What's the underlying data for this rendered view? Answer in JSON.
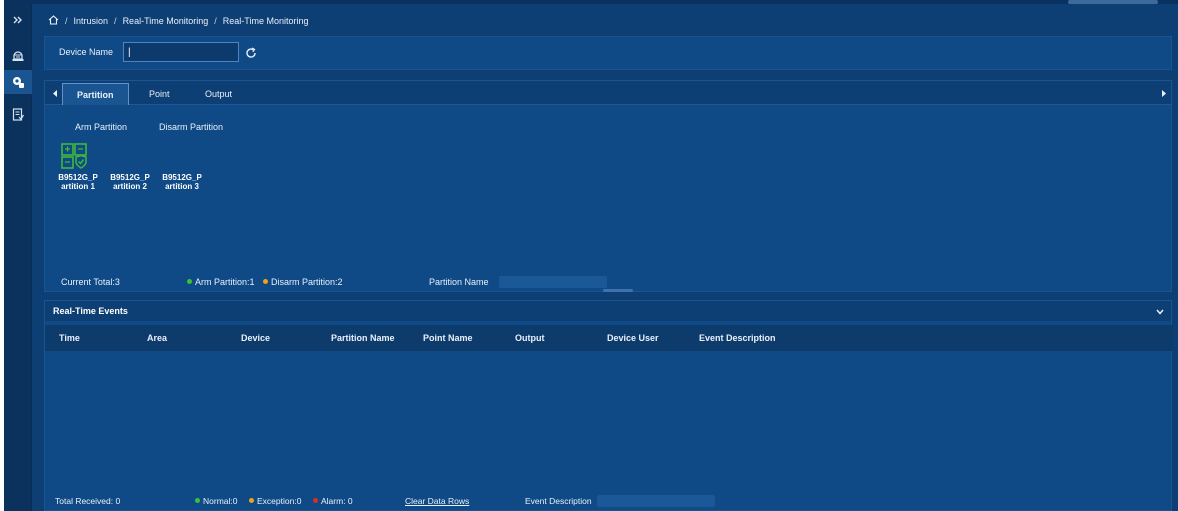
{
  "breadcrumb": {
    "items": [
      "Intrusion",
      "Real-Time Monitoring",
      "Real-Time Monitoring"
    ],
    "separator": "/"
  },
  "device": {
    "label": "Device Name",
    "value": "|"
  },
  "tabs": [
    {
      "label": "Partition",
      "active": true
    },
    {
      "label": "Point",
      "active": false
    },
    {
      "label": "Output",
      "active": false
    }
  ],
  "actions": {
    "arm": "Arm Partition",
    "disarm": "Disarm Partition"
  },
  "partitions": [
    {
      "line1": "B9512G_P",
      "line2": "artition 1",
      "state": "armed"
    },
    {
      "line1": "B9512G_P",
      "line2": "artition 2",
      "state": "disarmed"
    },
    {
      "line1": "B9512G_P",
      "line2": "artition 3",
      "state": "disarmed"
    }
  ],
  "partition_footer": {
    "current_total": "Current Total:3",
    "arm_count": "Arm Partition:1",
    "disarm_count": "Disarm Partition:2",
    "partition_name_label": "Partition Name"
  },
  "events": {
    "title": "Real-Time Events",
    "columns": [
      "Time",
      "Area",
      "Device",
      "Partition Name",
      "Point Name",
      "Output",
      "Device User",
      "Event Description"
    ],
    "rows": [],
    "footer": {
      "total_received": "Total Received: 0",
      "normal": "Normal:0",
      "exception": "Exception:0",
      "alarm": "Alarm: 0",
      "clear": "Clear Data Rows",
      "event_description_label": "Event Description"
    }
  },
  "colors": {
    "background": "#0d3f74",
    "panel": "#0f4a86",
    "rail": "#0b315d",
    "armed_green": "#3fb93a",
    "dot_normal": "#38c23a",
    "dot_exception": "#f0a21c",
    "dot_alarm": "#e02b2b"
  },
  "icons": {
    "rail": [
      "double-chevron-right-icon",
      "alarm-bell-icon",
      "monitoring-icon",
      "report-icon"
    ],
    "home": "home-icon",
    "refresh": "refresh-icon",
    "collapse": "chevron-down-icon"
  }
}
